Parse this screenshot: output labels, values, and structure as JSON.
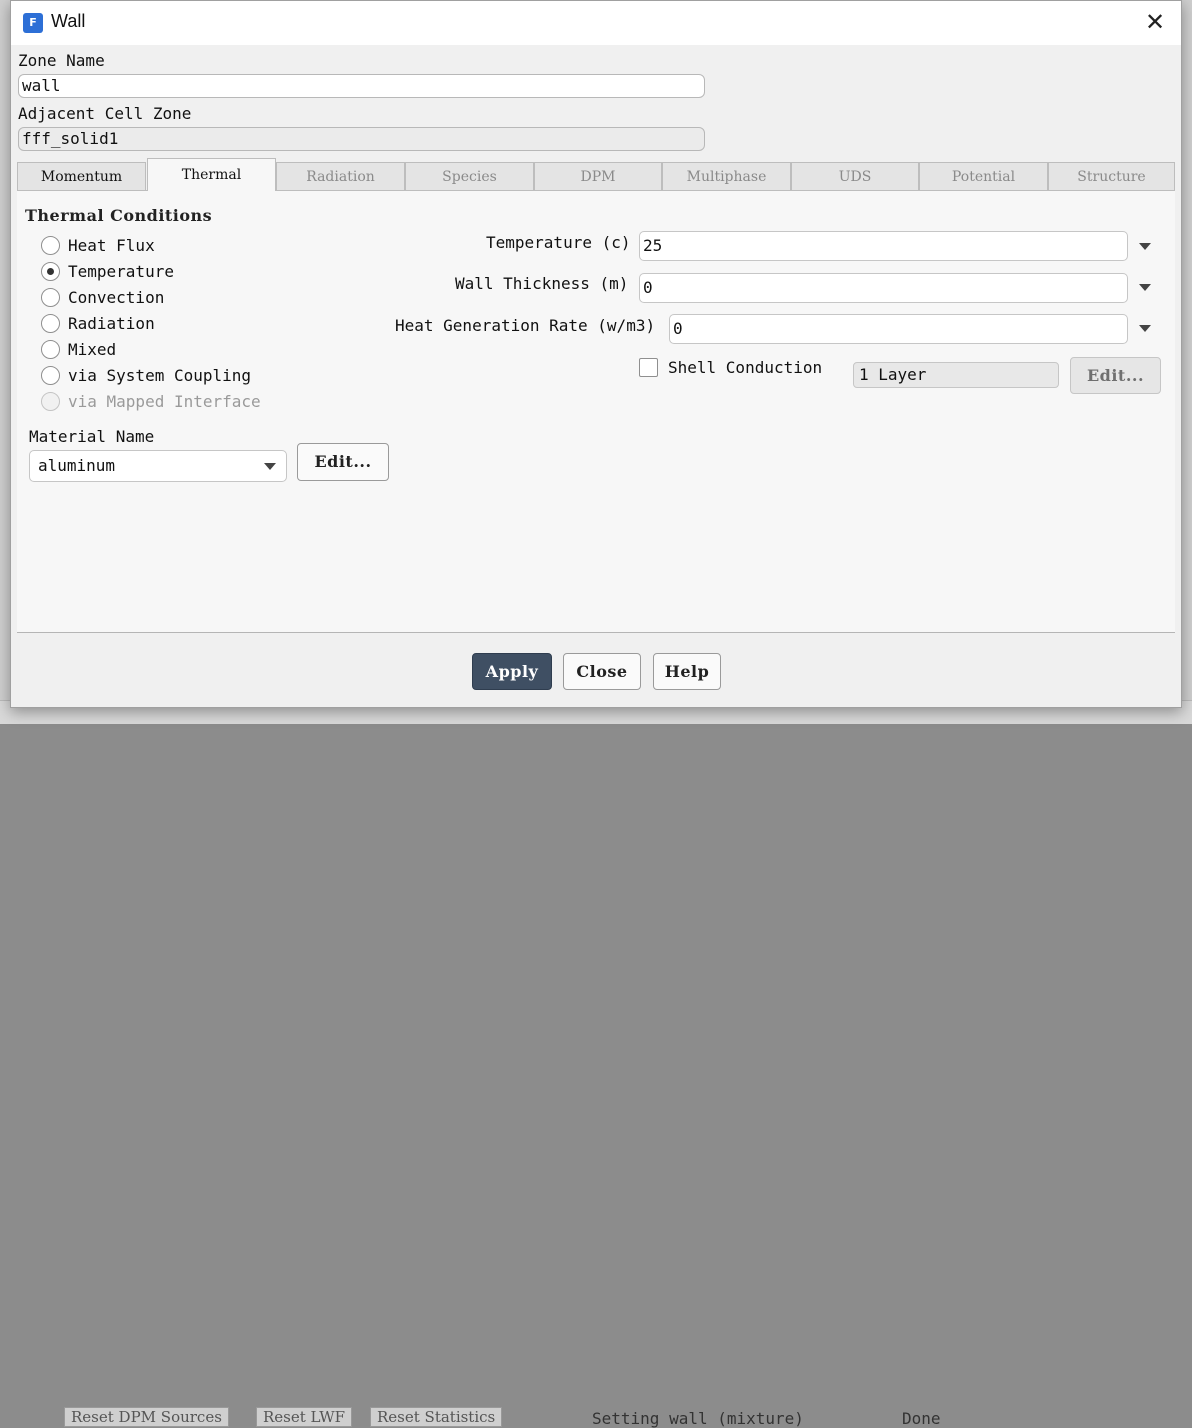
{
  "window": {
    "title": "Wall",
    "app_icon_letter": "F"
  },
  "zone_name": {
    "label": "Zone Name",
    "value": "wall"
  },
  "adjacent_cell_zone": {
    "label": "Adjacent Cell Zone",
    "value": "fff_solid1"
  },
  "tabs": [
    {
      "label": "Momentum",
      "state": "enabled"
    },
    {
      "label": "Thermal",
      "state": "active"
    },
    {
      "label": "Radiation",
      "state": "disabled"
    },
    {
      "label": "Species",
      "state": "disabled"
    },
    {
      "label": "DPM",
      "state": "disabled"
    },
    {
      "label": "Multiphase",
      "state": "disabled"
    },
    {
      "label": "UDS",
      "state": "disabled"
    },
    {
      "label": "Potential",
      "state": "disabled"
    },
    {
      "label": "Structure",
      "state": "disabled"
    }
  ],
  "thermal": {
    "section_title": "Thermal Conditions",
    "options": [
      {
        "label": "Heat Flux",
        "checked": false,
        "disabled": false
      },
      {
        "label": "Temperature",
        "checked": true,
        "disabled": false
      },
      {
        "label": "Convection",
        "checked": false,
        "disabled": false
      },
      {
        "label": "Radiation",
        "checked": false,
        "disabled": false
      },
      {
        "label": "Mixed",
        "checked": false,
        "disabled": false
      },
      {
        "label": "via System Coupling",
        "checked": false,
        "disabled": false
      },
      {
        "label": "via Mapped Interface",
        "checked": false,
        "disabled": true
      }
    ],
    "temperature": {
      "label": "Temperature (c)",
      "value": "25"
    },
    "wall_thickness": {
      "label": "Wall Thickness (m)",
      "value": "0"
    },
    "heat_generation": {
      "label": "Heat Generation Rate (w/m3)",
      "value": "0"
    },
    "shell_conduction": {
      "label": "Shell Conduction",
      "checked": false,
      "layers": "1 Layer",
      "edit_label": "Edit..."
    },
    "material": {
      "label": "Material Name",
      "value": "aluminum",
      "edit_label": "Edit..."
    }
  },
  "footer": {
    "apply": "Apply",
    "close": "Close",
    "help": "Help"
  },
  "background": {
    "buttons": [
      "Reset DPM Sources",
      "Reset LWF",
      "Reset Statistics"
    ],
    "console_text": "Setting wall (mixture)",
    "status_text": "Done"
  },
  "colors": {
    "primary_button": "#3f4f63",
    "app_icon": "#2d6fd6",
    "dialog_bg": "#f0f0f0"
  }
}
